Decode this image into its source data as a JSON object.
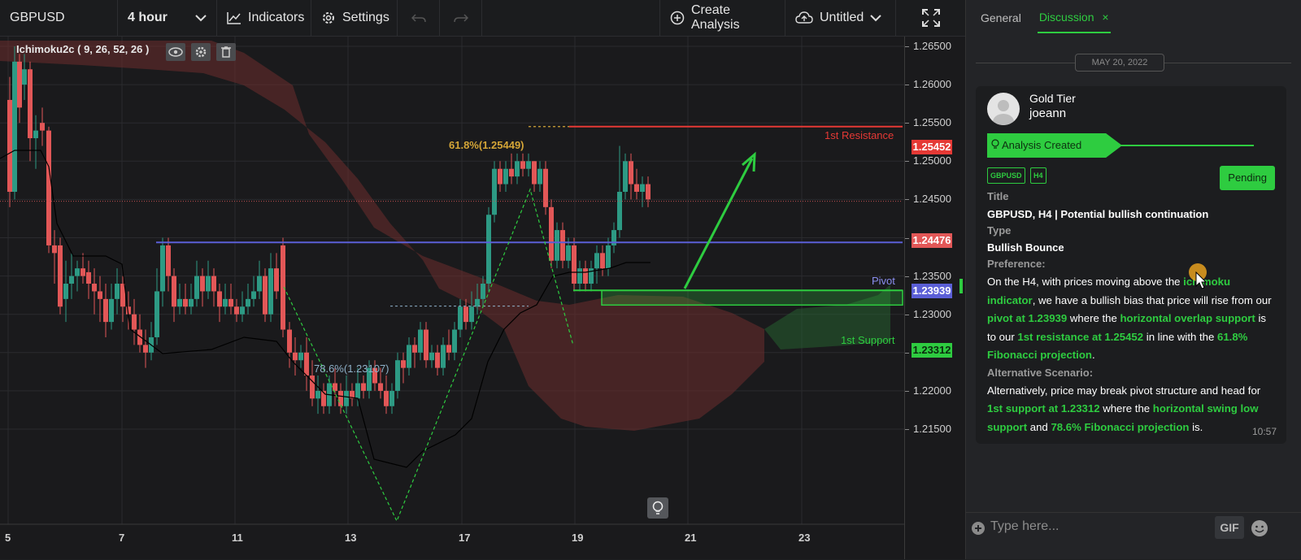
{
  "toolbar": {
    "symbol": "GBPUSD",
    "timeframe": "4 hour",
    "indicators": "Indicators",
    "settings": "Settings",
    "create_analysis": "Create Analysis",
    "untitled": "Untitled"
  },
  "chart": {
    "indicator_label": "Ichimoku2c ( 9, 26, 52, 26 )",
    "price_ticks": [
      "1.26500",
      "1.26000",
      "1.25500",
      "1.25000",
      "1.24500",
      "1.24000",
      "1.23500",
      "1.23000",
      "1.22500",
      "1.22000",
      "1.21500"
    ],
    "date_ticks": [
      "5",
      "7",
      "11",
      "13",
      "17",
      "19",
      "21",
      "23"
    ],
    "fib_618": "61.8%(1.25449)",
    "fib_786": "78.6%(1.23107)",
    "resistance_label": "1st Resistance",
    "pivot_label": "Pivot",
    "support_label": "1st Support",
    "price_labels": {
      "resistance": "1.25452",
      "current": "1.24476",
      "pivot": "1.23939",
      "support": "1.23312"
    },
    "colors": {
      "up": "#2d9a84",
      "down": "#e25757",
      "resistance": "#e53935",
      "pivot": "#5b5fd6",
      "support": "#2ecc40",
      "fib618": "#d4a537",
      "fib786": "#8fb1c9"
    }
  },
  "panel": {
    "tabs": [
      "General",
      "Discussion"
    ],
    "date": "MAY 20, 2022",
    "tier": "Gold Tier",
    "username": "joeann",
    "analysis_created": "Analysis Created",
    "tags": [
      "GBPUSD",
      "H4"
    ],
    "status": "Pending",
    "title_label": "Title",
    "title": "GBPUSD, H4 | Potential bullish continuation",
    "type_label": "Type",
    "type": "Bullish Bounce",
    "preference_label": "Preference:",
    "pref": {
      "t1": "On the H4, with prices moving above the ",
      "g1": "ichimoku indicator",
      "t2": ", we have a bullish bias that price will rise from our ",
      "g2": "pivot at 1.23939",
      "t3": " where the ",
      "g3": "horizontal overlap support",
      "t4": " is to our ",
      "g4": "1st resistance at 1.25452",
      "t5": " in line with the ",
      "g5": "61.8% Fibonacci projection",
      "t6": "."
    },
    "alt_label": "Alternative Scenario:",
    "alt": {
      "t1": "Alternatively, price may break pivot structure and head for ",
      "g1": "1st support at 1.23312",
      "t2": " where the ",
      "g2": "horizontal swing low support",
      "t3": " and ",
      "g3": "78.6% Fibonacci projection",
      "t4": " is."
    },
    "time": "10:57",
    "input_placeholder": "Type here...",
    "gif": "GIF"
  }
}
